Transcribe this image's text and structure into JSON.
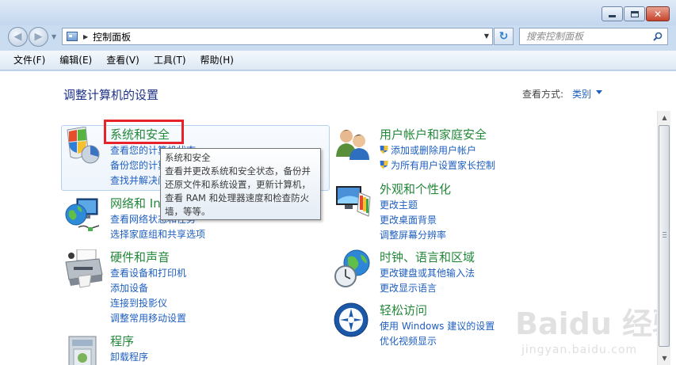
{
  "window": {
    "address": "控制面板",
    "search_placeholder": "搜索控制面板",
    "menu": [
      "文件(F)",
      "编辑(E)",
      "查看(V)",
      "工具(T)",
      "帮助(H)"
    ]
  },
  "page": {
    "title": "调整计算机的设置",
    "view_label": "查看方式:",
    "view_value": "类别"
  },
  "categories_left": [
    {
      "title": "系统和安全",
      "links": [
        "查看您的计算机状态",
        "备份您的计算机",
        "查找并解决问题"
      ],
      "icon": "shield-security-icon"
    },
    {
      "title": "网络和 Internet",
      "links": [
        "查看网络状态和任务",
        "选择家庭组和共享选项"
      ],
      "icon": "network-globe-icon"
    },
    {
      "title": "硬件和声音",
      "links": [
        "查看设备和打印机",
        "添加设备",
        "连接到投影仪",
        "调整常用移动设置"
      ],
      "icon": "printer-icon"
    },
    {
      "title": "程序",
      "links": [
        "卸载程序"
      ],
      "icon": "programs-icon"
    }
  ],
  "categories_right": [
    {
      "title": "用户帐户和家庭安全",
      "links": [
        "添加或删除用户帐户",
        "为所有用户设置家长控制"
      ],
      "icon": "users-icon"
    },
    {
      "title": "外观和个性化",
      "links": [
        "更改主题",
        "更改桌面背景",
        "调整屏幕分辨率"
      ],
      "icon": "appearance-icon"
    },
    {
      "title": "时钟、语言和区域",
      "links": [
        "更改键盘或其他输入法",
        "更改显示语言"
      ],
      "icon": "clock-globe-icon"
    },
    {
      "title": "轻松访问",
      "links": [
        "使用 Windows 建议的设置",
        "优化视频显示"
      ],
      "icon": "ease-of-access-icon"
    }
  ],
  "tooltip": {
    "lines": [
      "系统和安全",
      "查看并更改系统和安全状态，备份并",
      "还原文件和系统设置，更新计算机，",
      "查看 RAM 和处理器速度和检查防火",
      "墙，等等。"
    ]
  },
  "watermark": {
    "logo_text": "Baidu 经验",
    "url": "jingyan.baidu.com"
  },
  "colors": {
    "category_title": "#23883a",
    "link": "#1e5ebf",
    "highlight": "#e8222a"
  }
}
